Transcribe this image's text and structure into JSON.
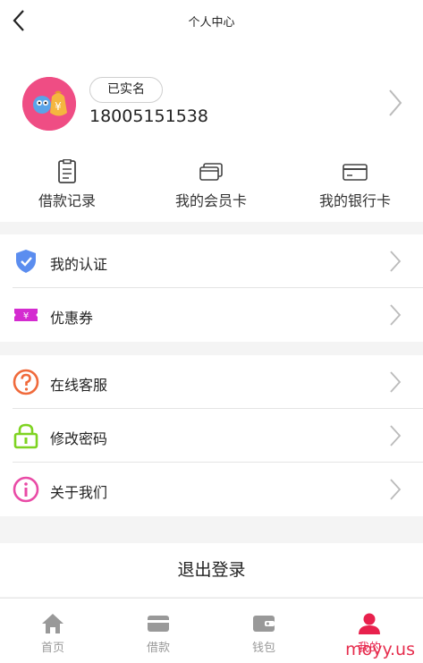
{
  "header": {
    "title": "个人中心",
    "back_icon": "chevron-left-icon"
  },
  "profile": {
    "badge": "已实名",
    "phone": "18005151538",
    "avatar_icon": "money-bag-mascot-icon"
  },
  "quick_links": [
    {
      "label": "借款记录",
      "icon": "document-icon"
    },
    {
      "label": "我的会员卡",
      "icon": "cards-icon"
    },
    {
      "label": "我的银行卡",
      "icon": "bank-card-icon"
    }
  ],
  "menu_group_1": [
    {
      "label": "我的认证",
      "icon": "shield-check-icon",
      "color": "#5b8def"
    },
    {
      "label": "优惠券",
      "icon": "coupon-icon",
      "color": "#d42bd0"
    }
  ],
  "menu_group_2": [
    {
      "label": "在线客服",
      "icon": "help-circle-icon",
      "color": "#f06a3b"
    },
    {
      "label": "修改密码",
      "icon": "lock-icon",
      "color": "#7ed321"
    },
    {
      "label": "关于我们",
      "icon": "info-circle-icon",
      "color": "#e94ba6"
    }
  ],
  "logout_label": "退出登录",
  "tabbar": [
    {
      "label": "首页",
      "icon": "home-icon"
    },
    {
      "label": "借款",
      "icon": "card-icon"
    },
    {
      "label": "钱包",
      "icon": "wallet-icon"
    },
    {
      "label": "我的",
      "icon": "user-icon",
      "active": true
    }
  ],
  "colors": {
    "accent": "#e8214d",
    "inactive": "#999999"
  },
  "watermark": "moyy.us"
}
